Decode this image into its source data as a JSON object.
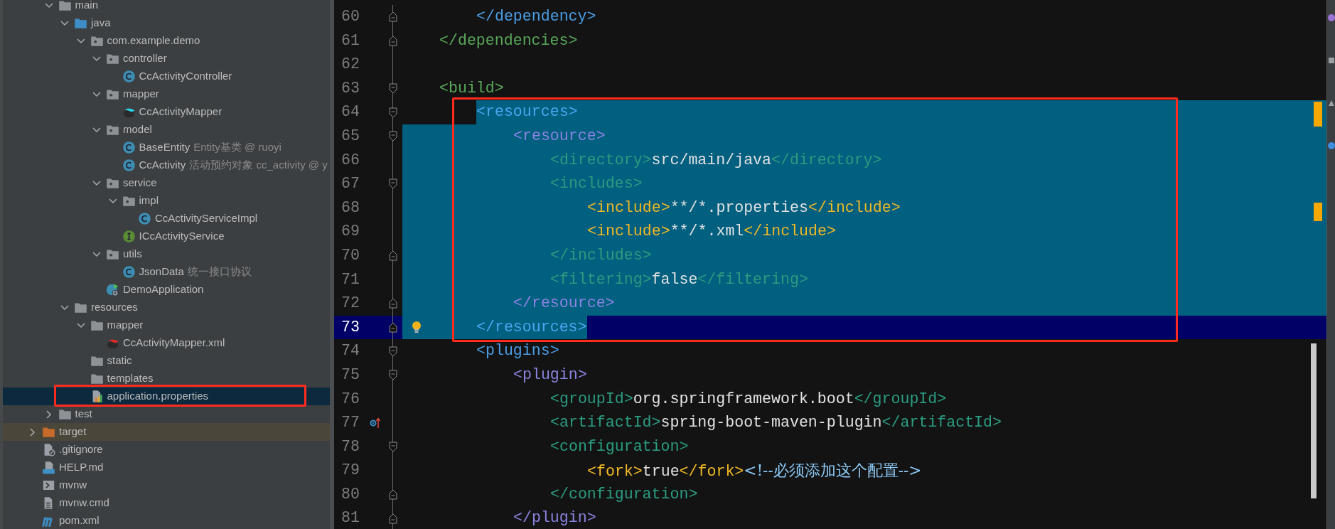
{
  "project_tree": {
    "framed_selection": true,
    "clipped_branch": [
      {
        "label": "main",
        "kind": "folder",
        "expanded": true,
        "selected": false,
        "children": [
          {
            "label": "java",
            "kind": "source-folder",
            "expanded": true,
            "selected": false,
            "children": [
              {
                "label": "com.example.demo",
                "kind": "package",
                "expanded": true,
                "selected": false,
                "children": [
                  {
                    "label": "controller",
                    "kind": "package",
                    "expanded": true,
                    "selected": false,
                    "children": [
                      {
                        "label": "CcActivityController",
                        "kind": "class",
                        "selected": false
                      }
                    ]
                  },
                  {
                    "label": "mapper",
                    "kind": "package",
                    "expanded": true,
                    "selected": false,
                    "children": [
                      {
                        "label": "CcActivityMapper",
                        "kind": "mapper",
                        "selected": false
                      }
                    ]
                  },
                  {
                    "label": "model",
                    "kind": "package",
                    "expanded": true,
                    "selected": false,
                    "children": [
                      {
                        "label": "BaseEntity",
                        "note": "Entity基类 @ ruoyi",
                        "kind": "class",
                        "selected": false
                      },
                      {
                        "label": "CcActivity",
                        "note": "活动预约对象 cc_activity @ y",
                        "kind": "class",
                        "selected": false
                      }
                    ]
                  },
                  {
                    "label": "service",
                    "kind": "package",
                    "expanded": true,
                    "selected": false,
                    "children": [
                      {
                        "label": "impl",
                        "kind": "package",
                        "expanded": true,
                        "selected": false,
                        "children": [
                          {
                            "label": "CcActivityServiceImpl",
                            "kind": "class",
                            "selected": false
                          }
                        ]
                      },
                      {
                        "label": "ICcActivityService",
                        "kind": "interface",
                        "selected": false
                      }
                    ]
                  },
                  {
                    "label": "utils",
                    "kind": "package",
                    "expanded": true,
                    "selected": false,
                    "children": [
                      {
                        "label": "JsonData",
                        "note": "统一接口协议",
                        "kind": "class",
                        "selected": false
                      }
                    ]
                  },
                  {
                    "label": "DemoApplication",
                    "kind": "spring-app",
                    "selected": false
                  }
                ]
              }
            ]
          },
          {
            "label": "resources",
            "kind": "folder",
            "expanded": true,
            "selected": false,
            "children": [
              {
                "label": "mapper",
                "kind": "folder",
                "expanded": true,
                "selected": false,
                "children": [
                  {
                    "label": "CcActivityMapper.xml",
                    "kind": "mapper-xml",
                    "selected": false
                  }
                ]
              },
              {
                "label": "static",
                "kind": "folder",
                "selected": false
              },
              {
                "label": "templates",
                "kind": "folder",
                "selected": false
              },
              {
                "label": "application.properties",
                "kind": "properties",
                "selected": true
              }
            ]
          }
        ]
      },
      {
        "label": "test",
        "kind": "folder",
        "expanded": false,
        "selected": false
      }
    ],
    "items": [
      {
        "label": "target",
        "kind": "excluded-folder",
        "expanded": false,
        "selected": false
      },
      {
        "label": ".gitignore",
        "kind": "gitignore",
        "selected": false
      },
      {
        "label": "HELP.md",
        "kind": "markdown",
        "selected": false
      },
      {
        "label": "mvnw",
        "kind": "shell",
        "selected": false
      },
      {
        "label": "mvnw.cmd",
        "kind": "cmd",
        "selected": false
      },
      {
        "label": "pom.xml",
        "kind": "maven",
        "selected": false
      }
    ]
  },
  "editor": {
    "framed_selection": true,
    "clipped_lines": [
      {
        "number": "60",
        "kind": "close-tag",
        "selected": false,
        "current": false,
        "overrides": false,
        "segments": [
          {
            "kind": "tag",
            "text": "</dependency>",
            "color": "#4a9ee6"
          }
        ]
      }
    ],
    "lines": [
      {
        "number": "61",
        "kind": "close-tag",
        "selected": false,
        "current": false,
        "overrides": false,
        "segments": [
          {
            "kind": "tag",
            "text": "</dependencies>",
            "color": "#5aa85a"
          }
        ]
      },
      {
        "number": "62",
        "selected": false,
        "current": false,
        "overrides": false
      },
      {
        "number": "63",
        "kind": "open-tag",
        "selected": false,
        "current": false,
        "overrides": false,
        "segments": [
          {
            "kind": "tag",
            "text": "<build>",
            "color": "#5aa85a"
          }
        ],
        "children": [
          {
            "number": "64",
            "kind": "open-tag",
            "selected": true,
            "current": false,
            "overrides": false,
            "segments": [
              {
                "kind": "tag",
                "text": "<resources>",
                "color": "#4aa6ef"
              }
            ],
            "children": [
              {
                "number": "65",
                "kind": "open-tag",
                "selected": true,
                "current": false,
                "overrides": false,
                "segments": [
                  {
                    "kind": "tag",
                    "text": "<resource>",
                    "color": "#8b84e0"
                  }
                ],
                "children": [
                  {
                    "number": "66",
                    "selected": true,
                    "current": false,
                    "overrides": false,
                    "segments": [
                      {
                        "kind": "tag",
                        "text": "<directory>",
                        "color": "#2e9b7e"
                      },
                      {
                        "kind": "value",
                        "text": "src/main/java"
                      },
                      {
                        "kind": "tag",
                        "text": "</directory>",
                        "color": "#2e9b7e"
                      }
                    ]
                  },
                  {
                    "number": "67",
                    "kind": "open-tag",
                    "selected": true,
                    "current": false,
                    "overrides": false,
                    "segments": [
                      {
                        "kind": "tag",
                        "text": "<includes>",
                        "color": "#2e9b7e"
                      }
                    ],
                    "children": [
                      {
                        "number": "68",
                        "selected": true,
                        "current": false,
                        "overrides": false,
                        "segments": [
                          {
                            "kind": "tag",
                            "text": "<include>",
                            "color": "#f0b824"
                          },
                          {
                            "kind": "value",
                            "text": "**/*.properties"
                          },
                          {
                            "kind": "tag",
                            "text": "</include>",
                            "color": "#f0b824"
                          }
                        ]
                      },
                      {
                        "number": "69",
                        "selected": true,
                        "current": false,
                        "overrides": false,
                        "segments": [
                          {
                            "kind": "tag",
                            "text": "<include>",
                            "color": "#f0b824"
                          },
                          {
                            "kind": "value",
                            "text": "**/*.xml"
                          },
                          {
                            "kind": "tag",
                            "text": "</include>",
                            "color": "#f0b824"
                          }
                        ]
                      }
                    ]
                  },
                  {
                    "number": "70",
                    "kind": "close-tag",
                    "selected": true,
                    "current": false,
                    "overrides": false,
                    "segments": [
                      {
                        "kind": "tag",
                        "text": "</includes>",
                        "color": "#2e9b7e"
                      }
                    ]
                  },
                  {
                    "number": "71",
                    "selected": true,
                    "current": false,
                    "overrides": false,
                    "segments": [
                      {
                        "kind": "tag",
                        "text": "<filtering>",
                        "color": "#2e9b7e"
                      },
                      {
                        "kind": "value",
                        "text": "false"
                      },
                      {
                        "kind": "tag",
                        "text": "</filtering>",
                        "color": "#2e9b7e"
                      }
                    ]
                  }
                ]
              },
              {
                "number": "72",
                "kind": "close-tag",
                "selected": true,
                "current": false,
                "overrides": false,
                "segments": [
                  {
                    "kind": "tag",
                    "text": "</resource>",
                    "color": "#8b84e0"
                  }
                ]
              }
            ]
          },
          {
            "number": "73",
            "kind": "close-tag",
            "selected": true,
            "current": true,
            "overrides": false,
            "segments": [
              {
                "kind": "tag",
                "text": "</resources>",
                "color": "#4aa6ef"
              }
            ]
          },
          {
            "number": "74",
            "kind": "open-tag",
            "selected": false,
            "current": false,
            "overrides": false,
            "segments": [
              {
                "kind": "tag",
                "text": "<plugins>",
                "color": "#4a9ee6"
              }
            ],
            "children": [
              {
                "number": "75",
                "kind": "open-tag",
                "selected": false,
                "current": false,
                "overrides": false,
                "segments": [
                  {
                    "kind": "tag",
                    "text": "<plugin>",
                    "color": "#8b84e0"
                  }
                ],
                "children": [
                  {
                    "number": "76",
                    "selected": false,
                    "current": false,
                    "overrides": false,
                    "segments": [
                      {
                        "kind": "tag",
                        "text": "<groupId>",
                        "color": "#2a9d82"
                      },
                      {
                        "kind": "value",
                        "text": "org.springframework.boot"
                      },
                      {
                        "kind": "tag",
                        "text": "</groupId>",
                        "color": "#2a9d82"
                      }
                    ]
                  },
                  {
                    "number": "77",
                    "selected": false,
                    "current": false,
                    "overrides": true,
                    "segments": [
                      {
                        "kind": "tag",
                        "text": "<artifactId>",
                        "color": "#2a9d82"
                      },
                      {
                        "kind": "value",
                        "text": "spring-boot-maven-plugin"
                      },
                      {
                        "kind": "tag",
                        "text": "</artifactId>",
                        "color": "#2a9d82"
                      }
                    ]
                  },
                  {
                    "number": "78",
                    "kind": "open-tag",
                    "selected": false,
                    "current": false,
                    "overrides": false,
                    "segments": [
                      {
                        "kind": "tag",
                        "text": "<configuration>",
                        "color": "#2a9d82"
                      }
                    ],
                    "children": [
                      {
                        "number": "79",
                        "selected": false,
                        "current": false,
                        "overrides": false,
                        "segments": [
                          {
                            "kind": "tag",
                            "text": "<fork>",
                            "color": "#f0b824"
                          },
                          {
                            "kind": "value",
                            "text": "true"
                          },
                          {
                            "kind": "tag",
                            "text": "</fork>",
                            "color": "#f0b824"
                          },
                          {
                            "kind": "comment",
                            "text": "<!--必须添加这个配置-->"
                          }
                        ]
                      }
                    ]
                  },
                  {
                    "number": "80",
                    "kind": "close-tag",
                    "selected": false,
                    "current": false,
                    "overrides": false,
                    "segments": [
                      {
                        "kind": "tag",
                        "text": "</configuration>",
                        "color": "#2a9d82"
                      }
                    ]
                  }
                ]
              },
              {
                "number": "81",
                "kind": "close-tag",
                "selected": false,
                "current": false,
                "overrides": false,
                "segments": [
                  {
                    "kind": "tag",
                    "text": "</plugin>",
                    "color": "#8b84e0"
                  }
                ]
              }
            ]
          }
        ]
      }
    ]
  }
}
